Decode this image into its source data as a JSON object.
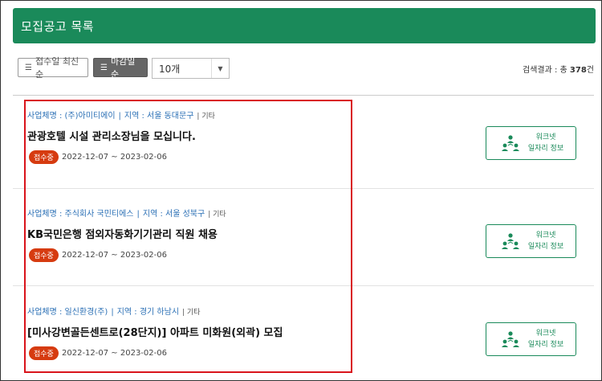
{
  "header": {
    "title": "모집공고 목록"
  },
  "toolbar": {
    "sort_date_label": "접수일 최신순",
    "sort_deadline_label": "마감일순",
    "page_size_value": "10개",
    "result_prefix": "검색결과 : 총 ",
    "result_count": "378",
    "result_suffix": "건"
  },
  "items": [
    {
      "company": "사업체명 : (주)아미티에이",
      "region": "지역 : 서울 동대문구",
      "etc": "| 기타",
      "title": "관광호텔 시설 관리소장님을 모십니다.",
      "status": "접수중",
      "period": "2022-12-07 ~ 2023-02-06",
      "worknet_line1": "워크넷",
      "worknet_line2": "일자리 정보"
    },
    {
      "company": "사업체명 : 주식회사 국민티에스",
      "region": "지역 : 서울 성북구",
      "etc": "| 기타",
      "title": "KB국민은행 점외자동화기기관리 직원 채용",
      "status": "접수중",
      "period": "2022-12-07 ~ 2023-02-06",
      "worknet_line1": "워크넷",
      "worknet_line2": "일자리 정보"
    },
    {
      "company": "사업체명 : 일신환경(주)",
      "region": "지역 : 경기 하남시",
      "etc": "| 기타",
      "title": "[미사강변골든센트로(28단지)] 아파트 미화원(외곽) 모집",
      "status": "접수중",
      "period": "2022-12-07 ~ 2023-02-06",
      "worknet_line1": "워크넷",
      "worknet_line2": "일자리 정보"
    }
  ],
  "colors": {
    "brand": "#1a8a5a",
    "status": "#d63b10",
    "link": "#2a6fb5",
    "highlight": "#d9141b"
  },
  "icons": {
    "sort": "list-icon",
    "select": "chevron-down-icon",
    "worknet": "people-network-icon"
  }
}
